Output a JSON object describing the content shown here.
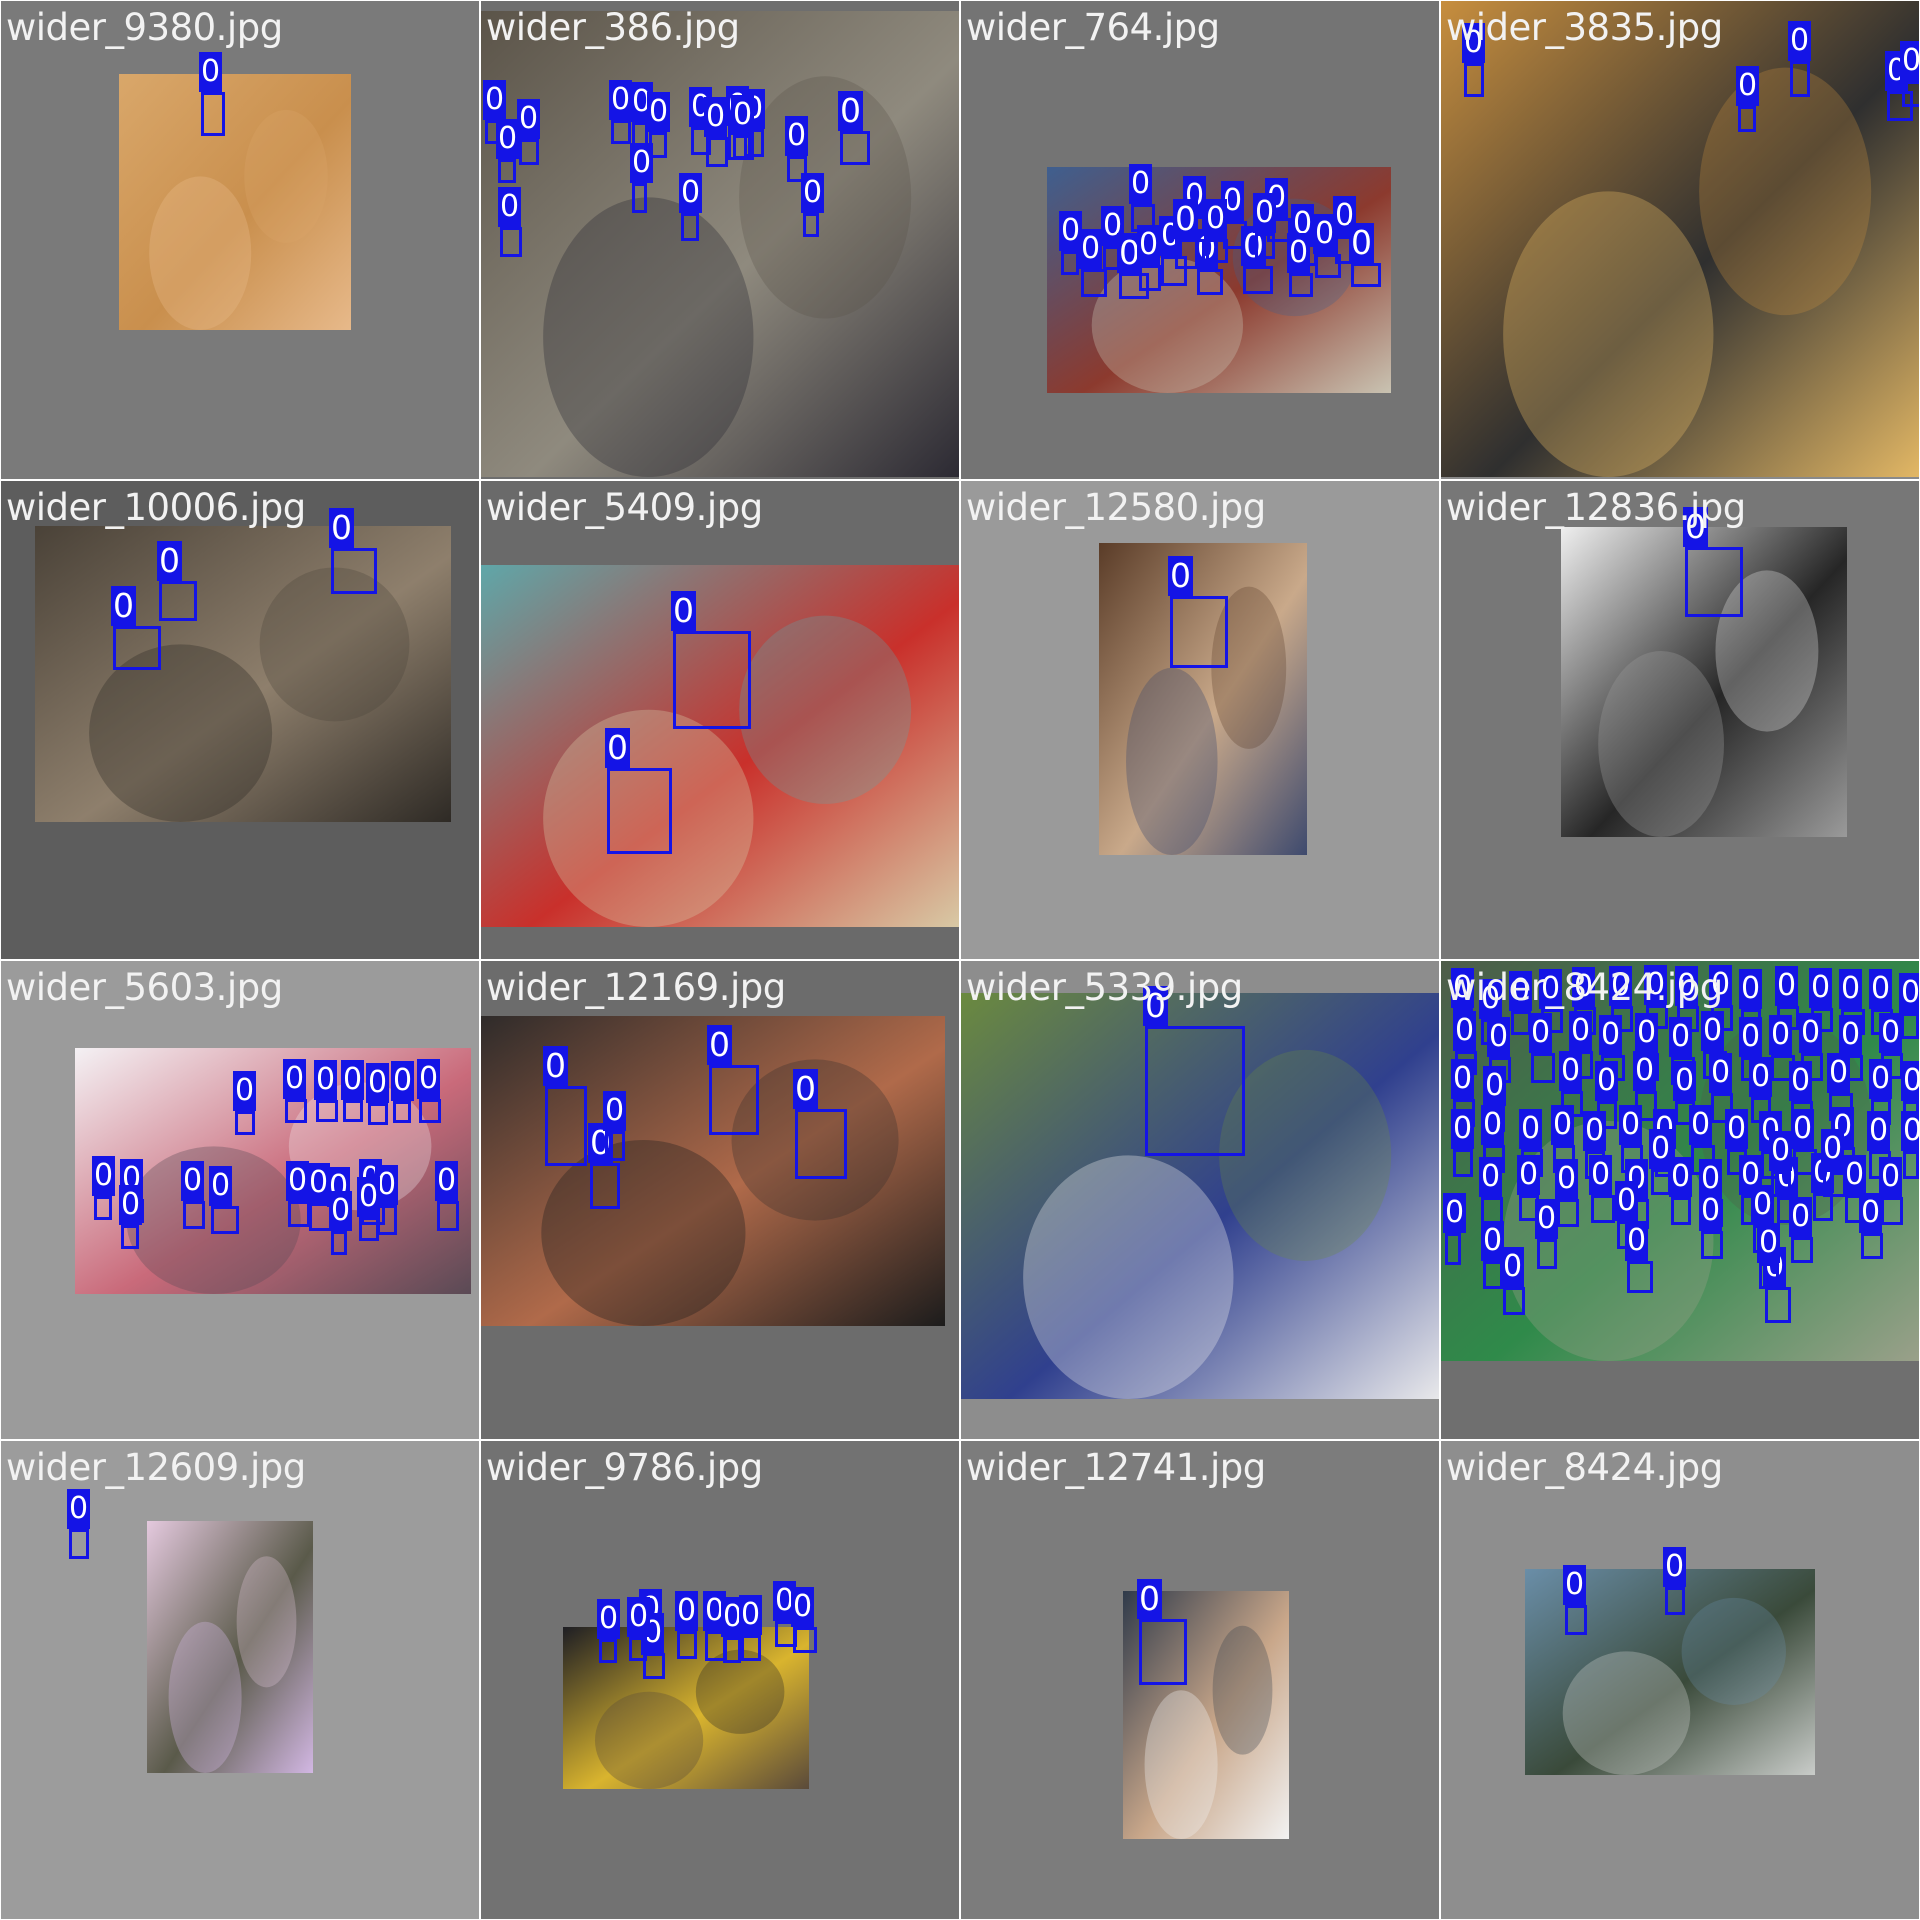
{
  "tiles": [
    {
      "label": "wider_9380.jpg",
      "bg": "#7a7a7a",
      "photo_colors": [
        "#d9a76a",
        "#c98f4d",
        "#e7b98a"
      ]
    },
    {
      "label": "wider_386.jpg",
      "bg": "#6e6e6e",
      "photo_colors": [
        "#5b5449",
        "#8f8a7e",
        "#2c2a33"
      ]
    },
    {
      "label": "wider_764.jpg",
      "bg": "#747474",
      "photo_colors": [
        "#3f5f8f",
        "#8c3a2e",
        "#c9c3b2"
      ]
    },
    {
      "label": "wider_3835.jpg",
      "bg": "#8a8a8a",
      "photo_colors": [
        "#c78e3e",
        "#2f2f2f",
        "#e2b765"
      ]
    },
    {
      "label": "wider_10006.jpg",
      "bg": "#5d5d5d",
      "photo_colors": [
        "#4a4238",
        "#8e7f6c",
        "#2e2a25"
      ]
    },
    {
      "label": "wider_5409.jpg",
      "bg": "#6a6a6a",
      "photo_colors": [
        "#5fa7a9",
        "#c9302b",
        "#d8c9a5"
      ]
    },
    {
      "label": "wider_12580.jpg",
      "bg": "#9a9a9a",
      "photo_colors": [
        "#5a3c28",
        "#c9a98a",
        "#3e4a6e"
      ]
    },
    {
      "label": "wider_12836.jpg",
      "bg": "#777777",
      "photo_colors": [
        "#efefef",
        "#262626",
        "#9a9a9a"
      ]
    },
    {
      "label": "wider_5603.jpg",
      "bg": "#9b9b9b",
      "photo_colors": [
        "#f4f1f4",
        "#c96a7a",
        "#5a4a55"
      ]
    },
    {
      "label": "wider_12169.jpg",
      "bg": "#6c6c6c",
      "photo_colors": [
        "#2f2b2a",
        "#b06a4a",
        "#1c1c1c"
      ]
    },
    {
      "label": "wider_5339.jpg",
      "bg": "#8d8d8d",
      "photo_colors": [
        "#6b8a3f",
        "#30408e",
        "#e8e8ea"
      ]
    },
    {
      "label": "wider_8424.jpg",
      "bg": "#6f6f6f",
      "photo_colors": [
        "#4e5c4a",
        "#2f8a4a",
        "#9aa08a"
      ]
    },
    {
      "label": "wider_12609.jpg",
      "bg": "#9c9c9c",
      "photo_colors": [
        "#e4c9de",
        "#5a5a4a",
        "#d2b7e3"
      ]
    },
    {
      "label": "wider_9786.jpg",
      "bg": "#727272",
      "photo_colors": [
        "#1e1e24",
        "#d9b42e",
        "#5a4a3a"
      ]
    },
    {
      "label": "wider_12741.jpg",
      "bg": "#7c7c7c",
      "photo_colors": [
        "#2f3a4a",
        "#c9a78a",
        "#f2f2f2"
      ]
    },
    {
      "label": "wider_8424.jpg",
      "bg": "#8e8e8e",
      "photo_colors": [
        "#6a8ea8",
        "#3a4a3a",
        "#c9ccc9"
      ]
    }
  ],
  "detection_class": "0",
  "box_color": "#1414e6"
}
